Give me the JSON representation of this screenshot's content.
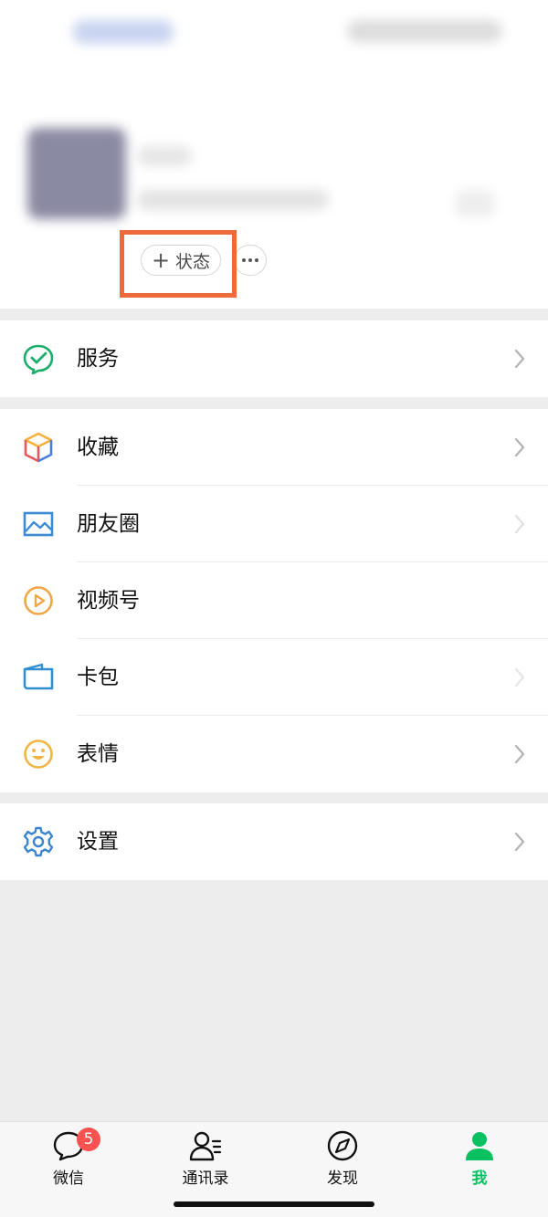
{
  "profile": {
    "status_button_label": "状态",
    "status_button_plus": "+"
  },
  "menu": {
    "services": {
      "label": "服务",
      "icon": "services-icon"
    },
    "favorites": {
      "label": "收藏",
      "icon": "favorites-icon"
    },
    "moments": {
      "label": "朋友圈",
      "icon": "moments-icon"
    },
    "channels": {
      "label": "视频号",
      "icon": "channels-icon"
    },
    "cards": {
      "label": "卡包",
      "icon": "card-wallet-icon"
    },
    "stickers": {
      "label": "表情",
      "icon": "stickers-icon"
    },
    "settings": {
      "label": "设置",
      "icon": "settings-icon"
    }
  },
  "tabbar": {
    "tabs": [
      {
        "label": "微信",
        "badge": "5"
      },
      {
        "label": "通讯录"
      },
      {
        "label": "发现"
      },
      {
        "label": "我"
      }
    ]
  },
  "colors": {
    "accent_green": "#07c160",
    "badge_red": "#fa5151",
    "highlight_orange": "#ef6a3a"
  }
}
